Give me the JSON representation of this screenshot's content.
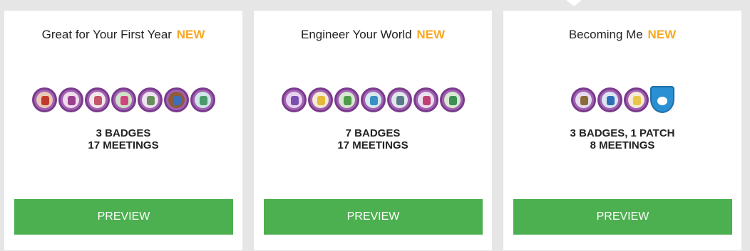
{
  "cards": [
    {
      "title": "Great for Your First Year",
      "new_label": "NEW",
      "badges_line": "3 BADGES",
      "meetings_line": "17 MEETINGS",
      "button_label": "PREVIEW",
      "icons": [
        "suitcase-badge-icon",
        "horse-badge-icon",
        "rope-badge-icon",
        "plant-badge-icon",
        "clock-badge-icon",
        "bird-badge-icon",
        "map-badge-icon"
      ]
    },
    {
      "title": "Engineer Your World",
      "new_label": "NEW",
      "badges_line": "7 BADGES",
      "meetings_line": "17 MEETINGS",
      "button_label": "PREVIEW",
      "icons": [
        "maze-badge-icon",
        "lightbulb-badge-icon",
        "tree-badge-icon",
        "bridge-badge-icon",
        "car-badge-icon",
        "robot-badge-icon",
        "leaf-badge-icon"
      ]
    },
    {
      "title": "Becoming Me",
      "new_label": "NEW",
      "badges_line": "3 BADGES, 1 PATCH",
      "meetings_line": "8 MEETINGS",
      "button_label": "PREVIEW",
      "icons": [
        "scales-badge-icon",
        "target-badge-icon",
        "pencil-badge-icon",
        "becoming-me-patch-icon"
      ]
    }
  ],
  "colors": {
    "new_accent": "#f7a823",
    "button_green": "#4caf50",
    "badge_border_purple": "#7a3a8c",
    "patch_blue": "#2b8fd4"
  }
}
